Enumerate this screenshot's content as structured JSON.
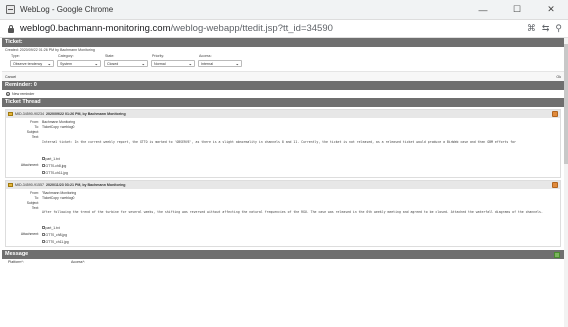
{
  "window": {
    "title": "WebLog - Google Chrome",
    "controls": {
      "minimize": "—",
      "maximize": "☐",
      "close": "✕"
    }
  },
  "url": {
    "host": "weblog0.bachmann-monitoring.com",
    "path": "/weblog-webapp/ttedit.jsp?tt_id=34590",
    "icons": [
      "key-icon",
      "translate-icon",
      "zoom-icon"
    ]
  },
  "ticket": {
    "header": "Ticket:",
    "created": "Created: 2020/09/22 01:26 PM by Bachmann Monitoring",
    "labels": {
      "type": "Type:",
      "category": "Category:",
      "state": "State:",
      "priority": "Priority:",
      "access": "Access:"
    },
    "values": {
      "type": "Observe tendency",
      "category": "System",
      "state": "Closed",
      "priority": "Normal",
      "access": "Internal"
    },
    "cancel": "Cancel",
    "ok": "Ok"
  },
  "reminder": {
    "header": "Reminder: 0",
    "new_link": "New reminder"
  },
  "thread": {
    "header": "Ticket Thread",
    "entries": [
      {
        "title_prefix": "MID-34590-90234",
        "title": "2020/09/22 01:26 PM, by Bachmann Monitoring",
        "from_label": "From:",
        "from": "Bachmann Monitoring",
        "to_label": "To:",
        "to": "TicketCopy <weblog0",
        "subject_label": "Subject:",
        "subject": "",
        "text_label": "Text:",
        "text": "Internal ticket: In the current weekly report, the GTTO is marked to 'OBSERVE', as there is a slight abnormality in channels 8 and 11. Currently, the ticket is not released, as a released ticket would produce a BinWeb case and then GBM efforts for",
        "attachment_label": "Attachment:",
        "attachments": [
          "part_1.txt",
          "GTT0-ch8.jpg",
          "GTT0-ch11.jpg"
        ]
      },
      {
        "title_prefix": "MID-34590-91557",
        "title": "2020/11/23 03:21 PM, by Bachmann Monitoring",
        "from_label": "From:",
        "from": "\"Bachmann Monitoring",
        "to_label": "To:",
        "to": "TicketCopy <weblog0",
        "subject_label": "Subject:",
        "subject": "",
        "text_label": "Text:",
        "text": "After following the trend of the turbine for several weeks, the shifting was reversed without affecting the natural frequencies of the RGU. The case was released in the        6th weekly meeting and agreed to be closed.  Attached the waterfall diagrams of the channels.",
        "attachment_label": "Attachment:",
        "attachments": [
          "part_1.txt",
          "GTT0_ch8.jpg",
          "GTT0_ch11.jpg"
        ]
      }
    ]
  },
  "message": {
    "header": "Message",
    "labels": {
      "platform": "Platform*:",
      "access": "Access*:"
    }
  }
}
